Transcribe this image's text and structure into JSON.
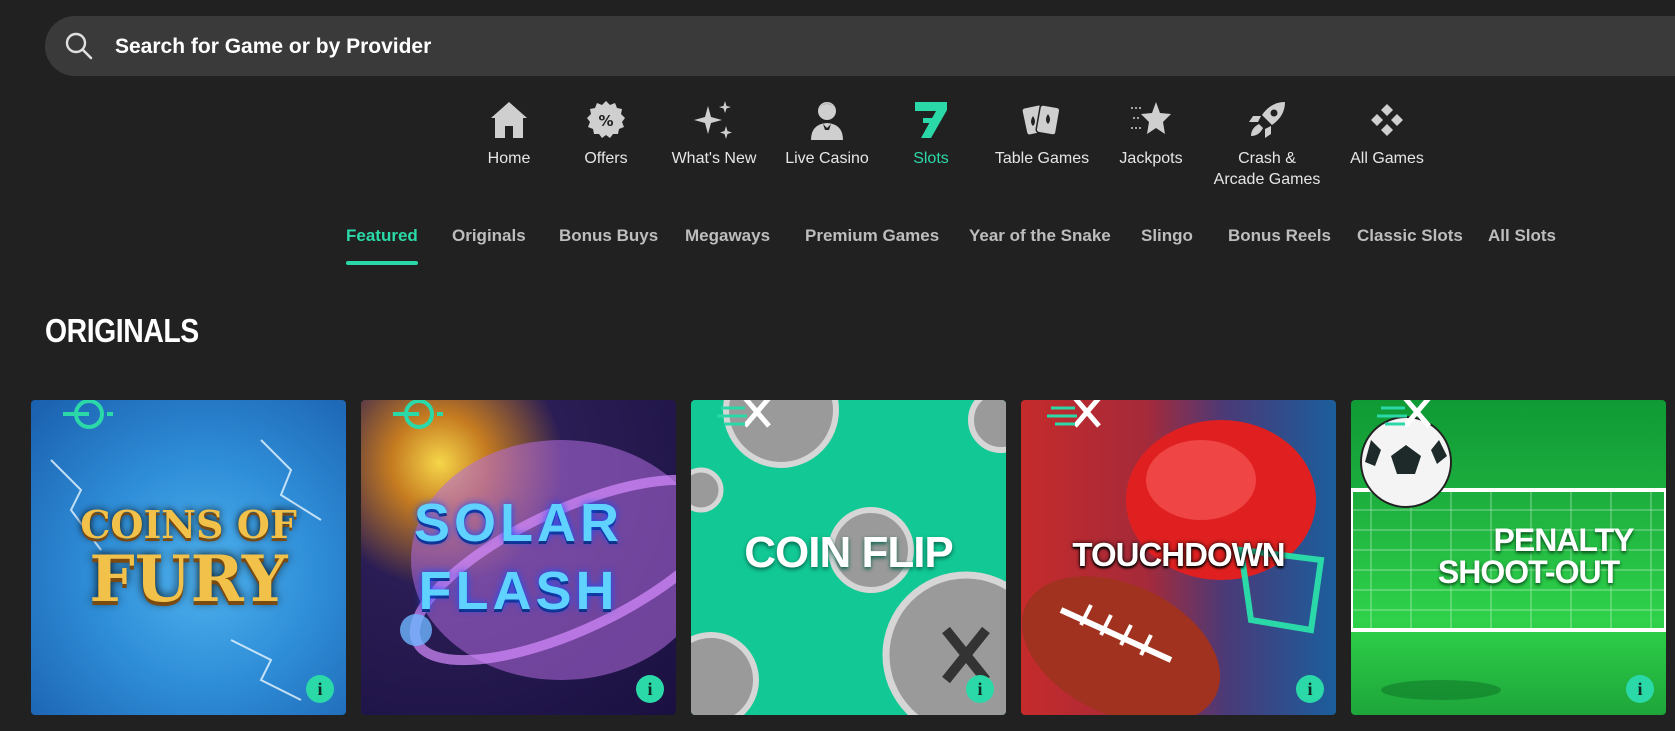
{
  "search": {
    "placeholder": "Search for Game or by Provider"
  },
  "categories": [
    {
      "label": "Home",
      "icon": "home-icon"
    },
    {
      "label": "Offers",
      "icon": "percent-badge-icon"
    },
    {
      "label": "What's New",
      "icon": "sparkles-icon"
    },
    {
      "label": "Live Casino",
      "icon": "dealer-icon"
    },
    {
      "label": "Slots",
      "icon": "seven-icon",
      "active": true
    },
    {
      "label": "Table Games",
      "icon": "playing-cards-icon"
    },
    {
      "label": "Jackpots",
      "icon": "star-icon"
    },
    {
      "label": "Crash &",
      "label2": "Arcade Games",
      "icon": "rocket-icon"
    },
    {
      "label": "All Games",
      "icon": "diamond-grid-icon"
    }
  ],
  "subnav": [
    "Featured",
    "Originals",
    "Bonus Buys",
    "Megaways",
    "Premium Games",
    "Year of the Snake",
    "Slingo",
    "Bonus Reels",
    "Classic Slots",
    "All Slots"
  ],
  "subnav_active": "Featured",
  "section_title": "ORIGINALS",
  "games": [
    {
      "title_line1": "COINS OF",
      "title_line2": "FURY",
      "badge": "target-icon"
    },
    {
      "title_line1": "SOLAR",
      "title_line2": "FLASH",
      "badge": "target-icon"
    },
    {
      "title_line1": "COIN FLIP",
      "title_line2": "",
      "badge": "speed-x-icon"
    },
    {
      "title_line1": "TOUCHDOWN",
      "title_line2": "",
      "badge": "speed-x-icon"
    },
    {
      "title_line1": "PENALTY",
      "title_line2": "SHOOT-OUT",
      "badge": "speed-x-icon"
    }
  ],
  "info_label": "i",
  "colors": {
    "accent": "#2bd9a8",
    "background": "#212121",
    "search_bg": "#3a3a3a"
  }
}
